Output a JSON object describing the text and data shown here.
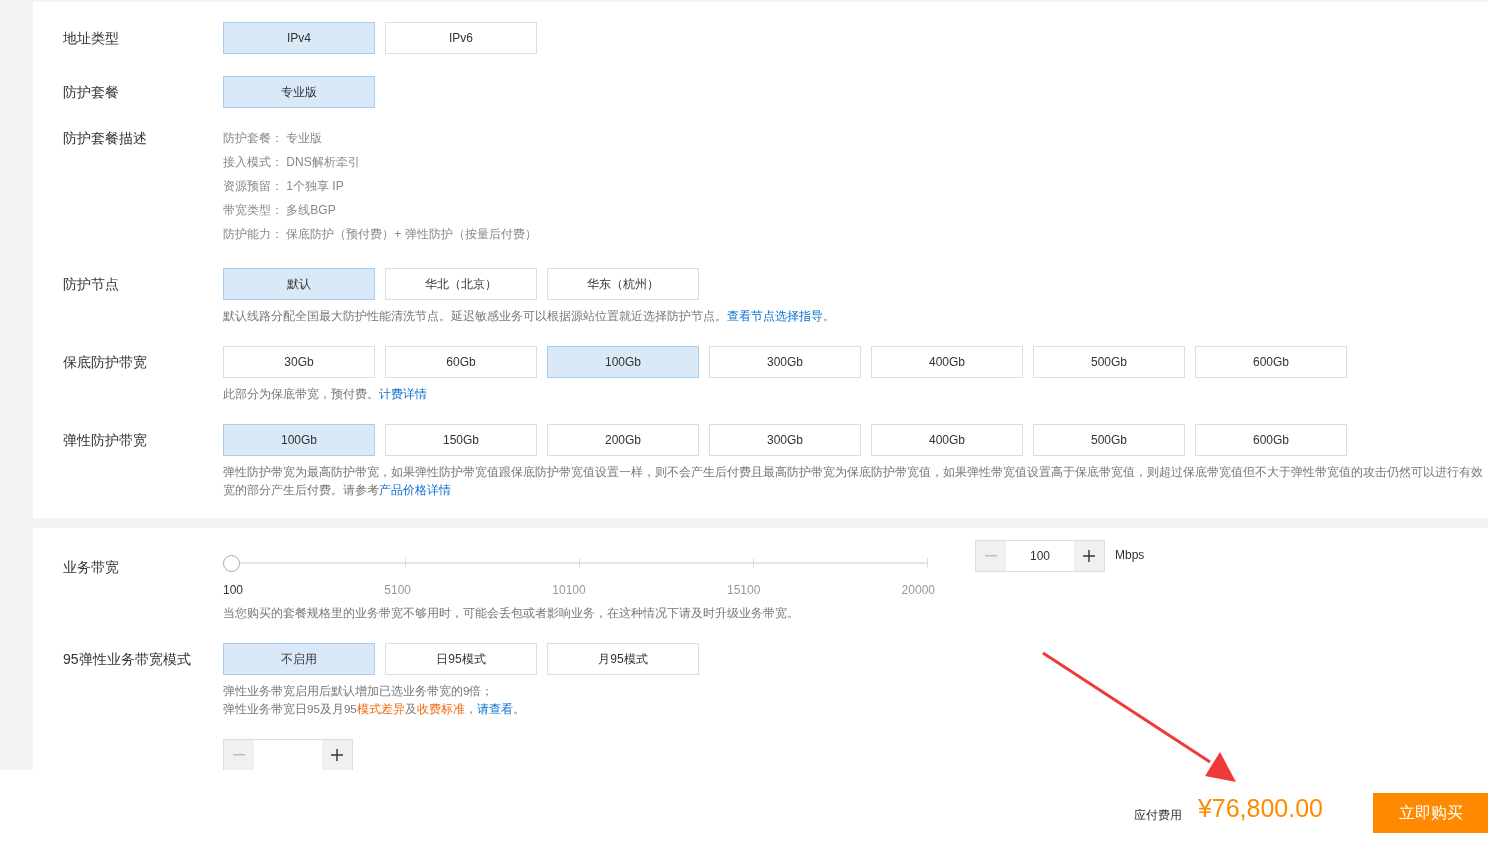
{
  "cards": [
    {
      "rows": [
        {
          "kind": "options",
          "label": "地址类型",
          "options": [
            {
              "label": "IPv4",
              "selected": true
            },
            {
              "label": "IPv6",
              "selected": false
            }
          ]
        },
        {
          "kind": "options",
          "label": "防护套餐",
          "options": [
            {
              "label": "专业版",
              "selected": true
            }
          ]
        },
        {
          "kind": "details",
          "label": "防护套餐描述",
          "lines": [
            {
              "name": "防护套餐：",
              "value": "专业版"
            },
            {
              "name": "接入模式：",
              "value": "DNS解析牵引"
            },
            {
              "name": "资源预留：",
              "value": "1个独享 IP"
            },
            {
              "name": "带宽类型：",
              "value": "多线BGP"
            },
            {
              "name": "防护能力：",
              "value": "保底防护（预付费）+ 弹性防护（按量后付费）"
            }
          ]
        },
        {
          "kind": "options",
          "label": "防护节点",
          "options": [
            {
              "label": "默认",
              "selected": true
            },
            {
              "label": "华北（北京）",
              "selected": false
            },
            {
              "label": "华东（杭州）",
              "selected": false
            }
          ],
          "notes": [
            [
              {
                "kind": "plain",
                "text": "默认线路分配全国最大防护性能清洗节点。延迟敏感业务可以根据源站位置就近选择防护节点。"
              },
              {
                "kind": "link",
                "text": "查看节点选择指导"
              },
              {
                "kind": "plain",
                "text": "。"
              }
            ]
          ]
        },
        {
          "kind": "options",
          "label": "保底防护带宽",
          "options": [
            {
              "label": "30Gb",
              "selected": false
            },
            {
              "label": "60Gb",
              "selected": false
            },
            {
              "label": "100Gb",
              "selected": true
            },
            {
              "label": "300Gb",
              "selected": false
            },
            {
              "label": "400Gb",
              "selected": false
            },
            {
              "label": "500Gb",
              "selected": false
            },
            {
              "label": "600Gb",
              "selected": false
            }
          ],
          "notes": [
            [
              {
                "kind": "plain",
                "text": "此部分为保底带宽，预付费。"
              },
              {
                "kind": "link",
                "text": "计费详情"
              }
            ]
          ]
        },
        {
          "kind": "options",
          "label": "弹性防护带宽",
          "options": [
            {
              "label": "100Gb",
              "selected": true
            },
            {
              "label": "150Gb",
              "selected": false
            },
            {
              "label": "200Gb",
              "selected": false
            },
            {
              "label": "300Gb",
              "selected": false
            },
            {
              "label": "400Gb",
              "selected": false
            },
            {
              "label": "500Gb",
              "selected": false
            },
            {
              "label": "600Gb",
              "selected": false
            }
          ],
          "notes": [
            [
              {
                "kind": "plain",
                "text": "弹性防护带宽为最高防护带宽，如果弹性防护带宽值跟保底防护带宽值设置一样，则不会产生后付费且最高防护带宽为保底防护带宽值，如果弹性带宽值设置高于保底带宽值，则超过保底带宽值但不大于弹性带宽值的攻击仍然可以进行有效"
              }
            ],
            [
              {
                "kind": "plain",
                "text": "宽的部分产生后付费。请参考"
              },
              {
                "kind": "link",
                "text": "产品价格详情"
              }
            ]
          ]
        }
      ]
    },
    {
      "rows": [
        {
          "kind": "slider",
          "label": "业务带宽",
          "level": 0,
          "ticks": [
            "100",
            "5100",
            "10100",
            "15100",
            "20000"
          ],
          "stepper": {
            "value": "100",
            "unit": "Mbps"
          },
          "notes": [
            [
              {
                "kind": "plain",
                "text": "当您购买的套餐规格里的业务带宽不够用时，可能会丢包或者影响业务，在这种情况下请及时升级业务带宽。"
              }
            ]
          ]
        },
        {
          "kind": "options",
          "label": "95弹性业务带宽模式",
          "options": [
            {
              "label": "不启用",
              "selected": true
            },
            {
              "label": "日95模式",
              "selected": false
            },
            {
              "label": "月95模式",
              "selected": false
            }
          ],
          "notes": [
            [
              {
                "kind": "plain",
                "text": "弹性业务带宽启用后默认增加已选业务带宽的9倍；"
              }
            ],
            [
              {
                "kind": "plain",
                "text": "弹性业务带宽日95及月95"
              },
              {
                "kind": "highlight",
                "text": "模式差异"
              },
              {
                "kind": "plain",
                "text": "及"
              },
              {
                "kind": "highlight",
                "text": "收费标准"
              },
              {
                "kind": "plain",
                "text": "，"
              },
              {
                "kind": "link",
                "text": "请查看"
              },
              {
                "kind": "plain",
                "text": "。"
              }
            ]
          ]
        },
        {
          "kind": "partial_stepper"
        }
      ]
    }
  ],
  "footer": {
    "label": "应付费用",
    "price": "¥76,800.00",
    "button": "立即购买"
  },
  "annotation": {
    "kind": "arrow"
  }
}
